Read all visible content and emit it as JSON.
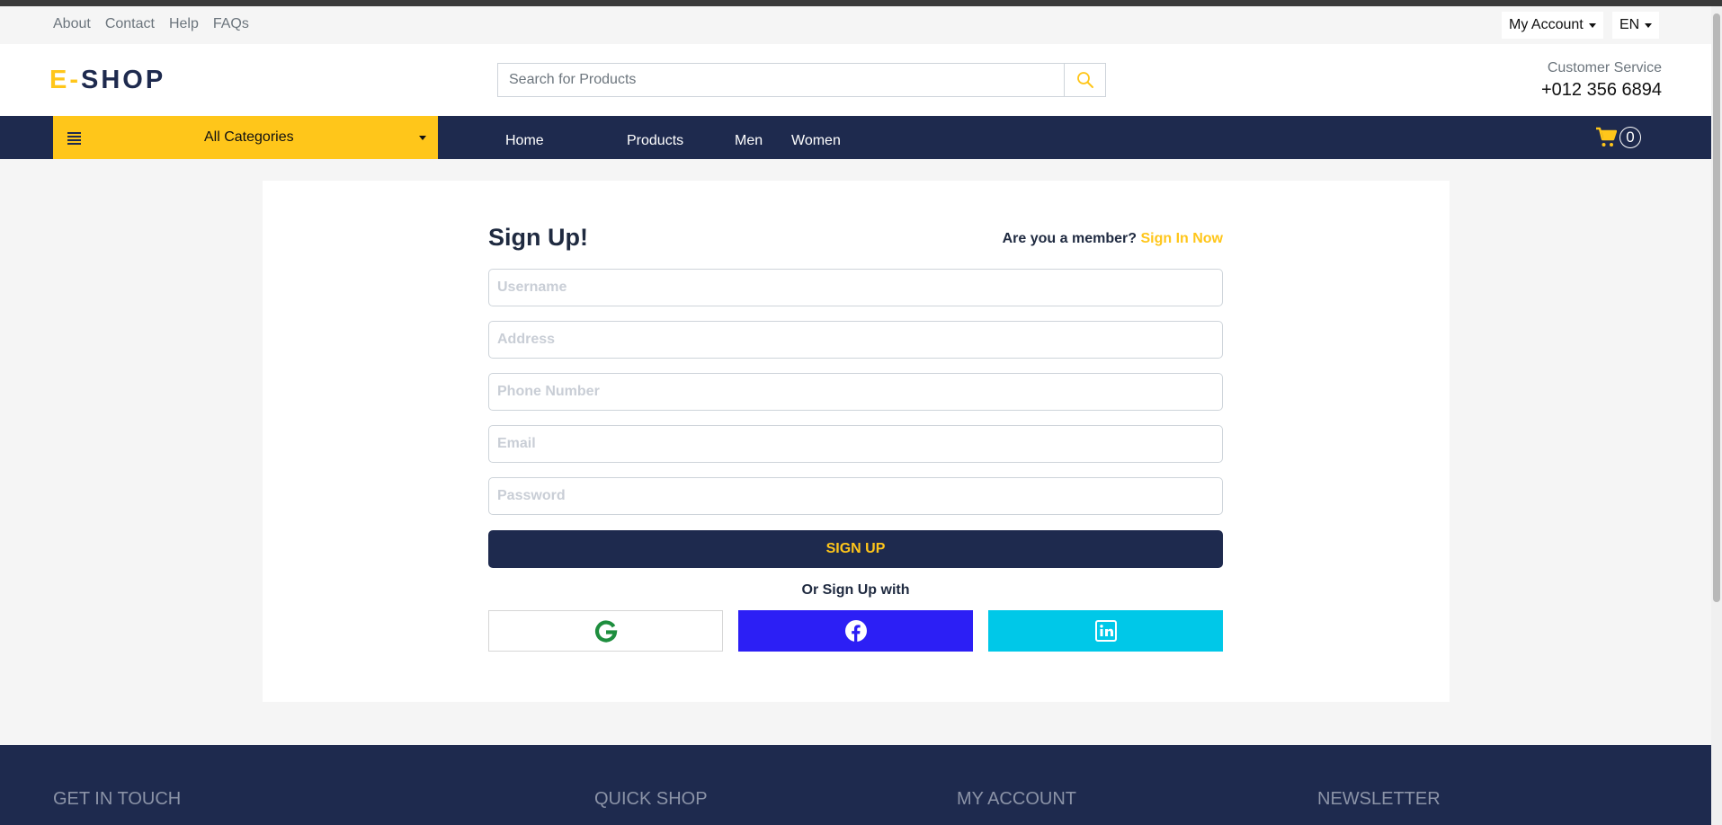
{
  "topbar": {
    "links": [
      "About",
      "Contact",
      "Help",
      "FAQs"
    ],
    "account_label": "My Account",
    "language_label": "EN"
  },
  "header": {
    "logo_prefix": "E-",
    "logo_main": "SHOP",
    "search_placeholder": "Search for Products",
    "customer_service_label": "Customer Service",
    "phone": "+012 356 6894"
  },
  "nav": {
    "categories_label": "All Categories",
    "links": [
      "Home",
      "Products",
      "Men",
      "Women"
    ],
    "cart_count": "0"
  },
  "signup": {
    "title": "Sign Up!",
    "member_prompt": "Are you a member?",
    "sign_in_link": "Sign In Now",
    "fields": {
      "username": "Username",
      "address": "Address",
      "phone": "Phone Number",
      "email": "Email",
      "password": "Password"
    },
    "submit_label": "SIGN UP",
    "social_prompt": "Or Sign Up with",
    "social": [
      {
        "icon": "google-icon",
        "color": "#ffffff"
      },
      {
        "icon": "facebook-icon",
        "color": "#2c1ff5"
      },
      {
        "icon": "linkedin-icon",
        "color": "#00c8e8"
      }
    ]
  },
  "footer": {
    "headings": [
      "GET IN TOUCH",
      "QUICK SHOP",
      "MY ACCOUNT",
      "NEWSLETTER"
    ]
  },
  "colors": {
    "accent": "#ffc61a",
    "navy": "#1e2a4e"
  }
}
